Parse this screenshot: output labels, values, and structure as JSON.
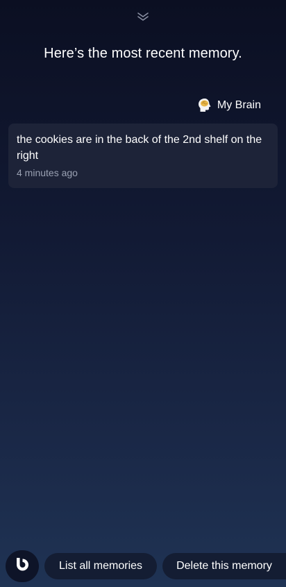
{
  "header": {
    "collapse_icon": "chevron-double-down-icon",
    "title": "Here’s the most recent memory."
  },
  "source": {
    "icon": "brain-icon",
    "label": "My Brain"
  },
  "memory": {
    "text": "the cookies are in the back of the 2nd shelf on the right",
    "time": "4 minutes ago"
  },
  "bottom_bar": {
    "assistant_icon": "bixby-icon",
    "suggestions": [
      {
        "label": "List all memories"
      },
      {
        "label": "Delete this memory"
      }
    ]
  },
  "colors": {
    "card_background": "#1d2338",
    "chip_background": "#141d33",
    "secondary_text": "#9aa1b3"
  }
}
